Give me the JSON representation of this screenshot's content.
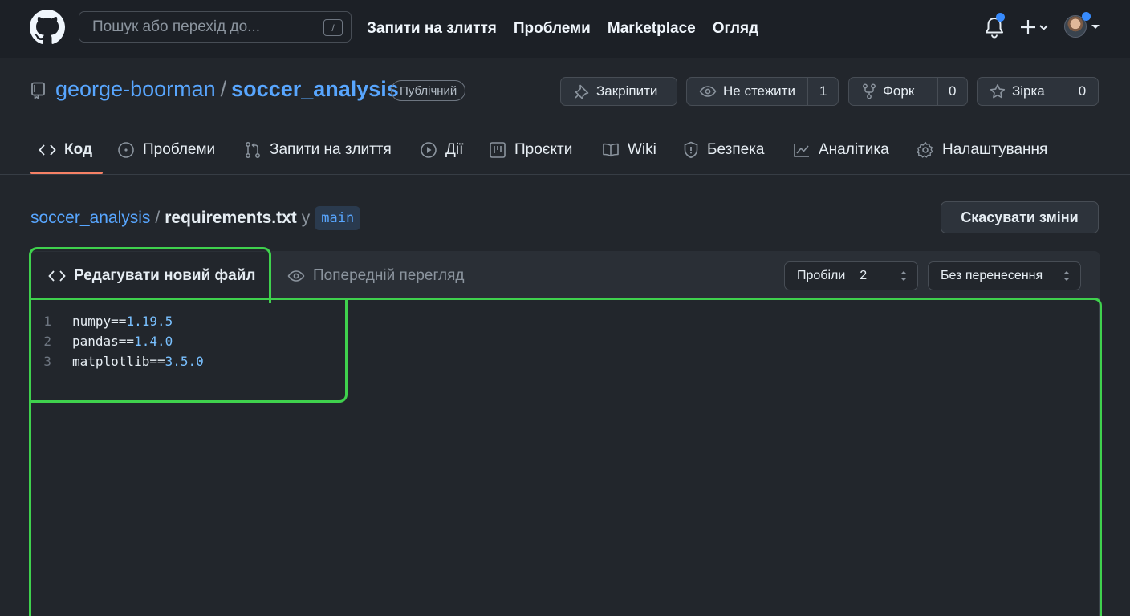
{
  "header": {
    "search_placeholder": "Пошук або перехід до...",
    "search_shortcut": "/",
    "nav": [
      "Запити на злиття",
      "Проблеми",
      "Marketplace",
      "Огляд"
    ]
  },
  "repo": {
    "owner": "george-boorman",
    "separator": "/",
    "name": "soccer_analysis",
    "visibility": "Публічний",
    "pin_label": "Закріпити",
    "watch_label": "Не стежити",
    "watch_count": "1",
    "fork_label": "Форк",
    "fork_count": "0",
    "star_label": "Зірка",
    "star_count": "0"
  },
  "tabs": {
    "code": "Код",
    "issues": "Проблеми",
    "pulls": "Запити на злиття",
    "actions": "Дії",
    "projects": "Проєкти",
    "wiki": "Wiki",
    "security": "Безпека",
    "insights": "Аналітика",
    "settings": "Налаштування"
  },
  "breadcrumb": {
    "repo": "soccer_analysis",
    "slash": "/",
    "file": "requirements.txt",
    "in": "у",
    "branch": "main"
  },
  "cancel_label": "Скасувати зміни",
  "editor": {
    "tab_edit": "Редагувати новий файл",
    "tab_preview": "Попередній перегляд",
    "indent_mode": "Пробіли",
    "indent_size": "2",
    "wrap_mode": "Без перенесення",
    "lines": [
      {
        "num": "1",
        "name": "numpy==",
        "version": "1.19.5"
      },
      {
        "num": "2",
        "name": "pandas==",
        "version": "1.4.0"
      },
      {
        "num": "3",
        "name": "matplotlib==",
        "version": "3.5.0"
      }
    ]
  },
  "colors": {
    "accent_link": "#58a6ff",
    "tab_underline": "#f78166",
    "highlight": "#3fd14d",
    "notification": "#388bfd"
  }
}
